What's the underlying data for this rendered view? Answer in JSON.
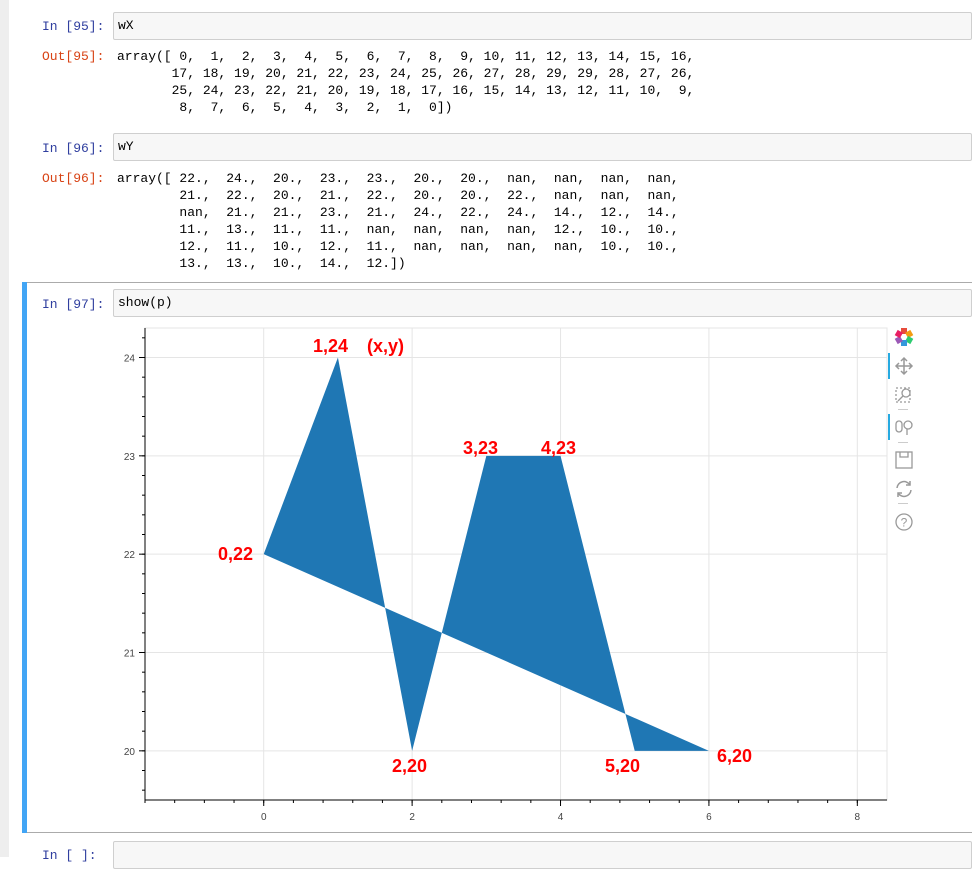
{
  "cells": [
    {
      "in_prompt": "In [95]:",
      "input": "wX",
      "out_prompt": "Out[95]:",
      "output": "array([ 0,  1,  2,  3,  4,  5,  6,  7,  8,  9, 10, 11, 12, 13, 14, 15, 16,\n       17, 18, 19, 20, 21, 22, 23, 24, 25, 26, 27, 28, 29, 29, 28, 27, 26,\n       25, 24, 23, 22, 21, 20, 19, 18, 17, 16, 15, 14, 13, 12, 11, 10,  9,\n        8,  7,  6,  5,  4,  3,  2,  1,  0])"
    },
    {
      "in_prompt": "In [96]:",
      "input": "wY",
      "out_prompt": "Out[96]:",
      "output": "array([ 22.,  24.,  20.,  23.,  23.,  20.,  20.,  nan,  nan,  nan,  nan,\n        21.,  22.,  20.,  21.,  22.,  20.,  20.,  22.,  nan,  nan,  nan,\n        nan,  21.,  21.,  23.,  21.,  24.,  22.,  24.,  14.,  12.,  14.,\n        11.,  13.,  11.,  11.,  nan,  nan,  nan,  nan,  12.,  10.,  10.,\n        12.,  11.,  10.,  12.,  11.,  nan,  nan,  nan,  nan,  10.,  10.,\n        13.,  13.,  10.,  14.,  12.])"
    },
    {
      "in_prompt": "In [97]:",
      "input": "show(p)"
    },
    {
      "in_prompt": "In [ ]:",
      "input": ""
    }
  ],
  "toolbar": {
    "logo": "bokeh-logo-icon",
    "tools": [
      "pan-icon",
      "box-zoom-icon",
      "wheel-zoom-icon",
      "save-icon",
      "reset-icon",
      "help-icon"
    ]
  },
  "colors": {
    "fill": "#1f77b4",
    "annotation": "#ff0000",
    "accent": "#42a5f5"
  },
  "chart_data": {
    "type": "area",
    "x": [
      0,
      1,
      2,
      3,
      4,
      5,
      6
    ],
    "y": [
      22,
      24,
      20,
      23,
      23,
      20,
      20
    ],
    "xlim": [
      -1.6,
      8.4
    ],
    "ylim": [
      19.5,
      24.3
    ],
    "x_ticks": [
      "0",
      "2",
      "4",
      "6",
      "8"
    ],
    "y_ticks": [
      "20",
      "21",
      "22",
      "23",
      "24"
    ],
    "grid": true,
    "annotations": [
      {
        "text": "0,22"
      },
      {
        "text": "1,24"
      },
      {
        "text": "(x,y)"
      },
      {
        "text": "2,20"
      },
      {
        "text": "3,23"
      },
      {
        "text": "4,23"
      },
      {
        "text": "5,20"
      },
      {
        "text": "6,20"
      }
    ]
  }
}
